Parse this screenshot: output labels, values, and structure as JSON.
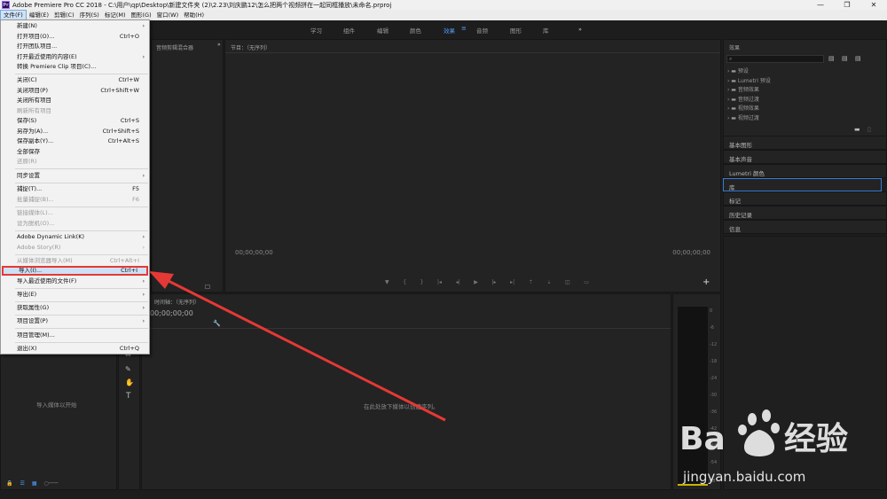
{
  "window": {
    "title": "Adobe Premiere Pro CC 2018 - C:\\用户\\qp\\Desktop\\新建文件夹 (2)\\2.23\\刘庆鹏12\\怎么把两个视频拼在一起同框播放\\未命名.prproj",
    "app_icon": "Pr",
    "controls": {
      "minimize": "—",
      "maximize": "❐",
      "close": "✕"
    }
  },
  "menubar": [
    "文件(F)",
    "编辑(E)",
    "剪辑(C)",
    "序列(S)",
    "标记(M)",
    "图形(G)",
    "窗口(W)",
    "帮助(H)"
  ],
  "workspaces": {
    "items": [
      "学习",
      "组件",
      "编辑",
      "颜色",
      "效果",
      "音频",
      "图形",
      "库"
    ],
    "active_index": 4,
    "more": "»"
  },
  "file_menu": {
    "items": [
      {
        "label": "新建(N)",
        "shortcut": "",
        "submenu": true,
        "disabled": false
      },
      {
        "label": "打开项目(O)...",
        "shortcut": "Ctrl+O",
        "submenu": false,
        "disabled": false
      },
      {
        "label": "打开团队项目...",
        "shortcut": "",
        "submenu": false,
        "disabled": false
      },
      {
        "label": "打开最近使用的内容(E)",
        "shortcut": "",
        "submenu": true,
        "disabled": false
      },
      {
        "label": "转换 Premiere Clip 项目(C)...",
        "shortcut": "",
        "submenu": false,
        "disabled": false
      },
      {
        "label": "关闭(C)",
        "shortcut": "Ctrl+W",
        "submenu": false,
        "disabled": false
      },
      {
        "label": "关闭项目(P)",
        "shortcut": "Ctrl+Shift+W",
        "submenu": false,
        "disabled": false
      },
      {
        "label": "关闭所有项目",
        "shortcut": "",
        "submenu": false,
        "disabled": false
      },
      {
        "label": "刷新所有项目",
        "shortcut": "",
        "submenu": false,
        "disabled": true
      },
      {
        "label": "保存(S)",
        "shortcut": "Ctrl+S",
        "submenu": false,
        "disabled": false
      },
      {
        "label": "另存为(A)...",
        "shortcut": "Ctrl+Shift+S",
        "submenu": false,
        "disabled": false
      },
      {
        "label": "保存副本(Y)...",
        "shortcut": "Ctrl+Alt+S",
        "submenu": false,
        "disabled": false
      },
      {
        "label": "全部保存",
        "shortcut": "",
        "submenu": false,
        "disabled": false
      },
      {
        "label": "还原(R)",
        "shortcut": "",
        "submenu": false,
        "disabled": true
      },
      {
        "label": "同步设置",
        "shortcut": "",
        "submenu": true,
        "disabled": false
      },
      {
        "label": "捕捉(T)...",
        "shortcut": "F5",
        "submenu": false,
        "disabled": false
      },
      {
        "label": "批量捕捉(B)...",
        "shortcut": "F6",
        "submenu": false,
        "disabled": true
      },
      {
        "label": "链接媒体(L)...",
        "shortcut": "",
        "submenu": false,
        "disabled": true
      },
      {
        "label": "设为脱机(O)...",
        "shortcut": "",
        "submenu": false,
        "disabled": true
      },
      {
        "label": "Adobe Dynamic Link(K)",
        "shortcut": "",
        "submenu": true,
        "disabled": false
      },
      {
        "label": "Adobe Story(R)",
        "shortcut": "",
        "submenu": true,
        "disabled": true
      },
      {
        "label": "从媒体浏览器导入(M)",
        "shortcut": "Ctrl+Alt+I",
        "submenu": false,
        "disabled": true
      },
      {
        "label": "导入(I)...",
        "shortcut": "Ctrl+I",
        "submenu": false,
        "disabled": false,
        "highlight": true
      },
      {
        "label": "导入最近使用的文件(F)",
        "shortcut": "",
        "submenu": true,
        "disabled": false
      },
      {
        "label": "导出(E)",
        "shortcut": "",
        "submenu": true,
        "disabled": false
      },
      {
        "label": "获取属性(G)",
        "shortcut": "",
        "submenu": true,
        "disabled": false
      },
      {
        "label": "项目设置(P)",
        "shortcut": "",
        "submenu": true,
        "disabled": false
      },
      {
        "label": "项目管理(M)...",
        "shortcut": "",
        "submenu": false,
        "disabled": false
      },
      {
        "label": "退出(X)",
        "shortcut": "Ctrl+Q",
        "submenu": false,
        "disabled": false
      }
    ]
  },
  "source_panel": {
    "tab": "音频剪辑混合器"
  },
  "program_monitor": {
    "tab": "节目：（无序列）",
    "timecode_left": "00;00;00;00",
    "timecode_right": "00;00;00;00",
    "add_button": "+"
  },
  "project_panel": {
    "empty_text": "导入媒体以开始"
  },
  "timeline": {
    "tab": "时间轴：（无序列）",
    "timecode": "00;00;00;00",
    "empty_text": "在此处放下媒体以创建序列。"
  },
  "audio_meter": {
    "scale": [
      "0",
      "-6",
      "-12",
      "-18",
      "-24",
      "-30",
      "-36",
      "-42",
      "-48",
      "-54",
      "dB"
    ]
  },
  "effects_panel": {
    "tab": "效果",
    "folders": [
      "预设",
      "Lumetri 预设",
      "音频效果",
      "音频过渡",
      "视频效果",
      "视频过渡"
    ],
    "tabs": [
      "基本图形",
      "基本声音",
      "Lumetri 颜色",
      "库",
      "标记",
      "历史记录",
      "信息"
    ],
    "active_tab_index": 3
  },
  "watermark": {
    "text": "jingyan.baidu.com"
  },
  "colors": {
    "accent": "#4f9cf7",
    "highlight_border": "#e53935",
    "arrow": "#e53935"
  }
}
